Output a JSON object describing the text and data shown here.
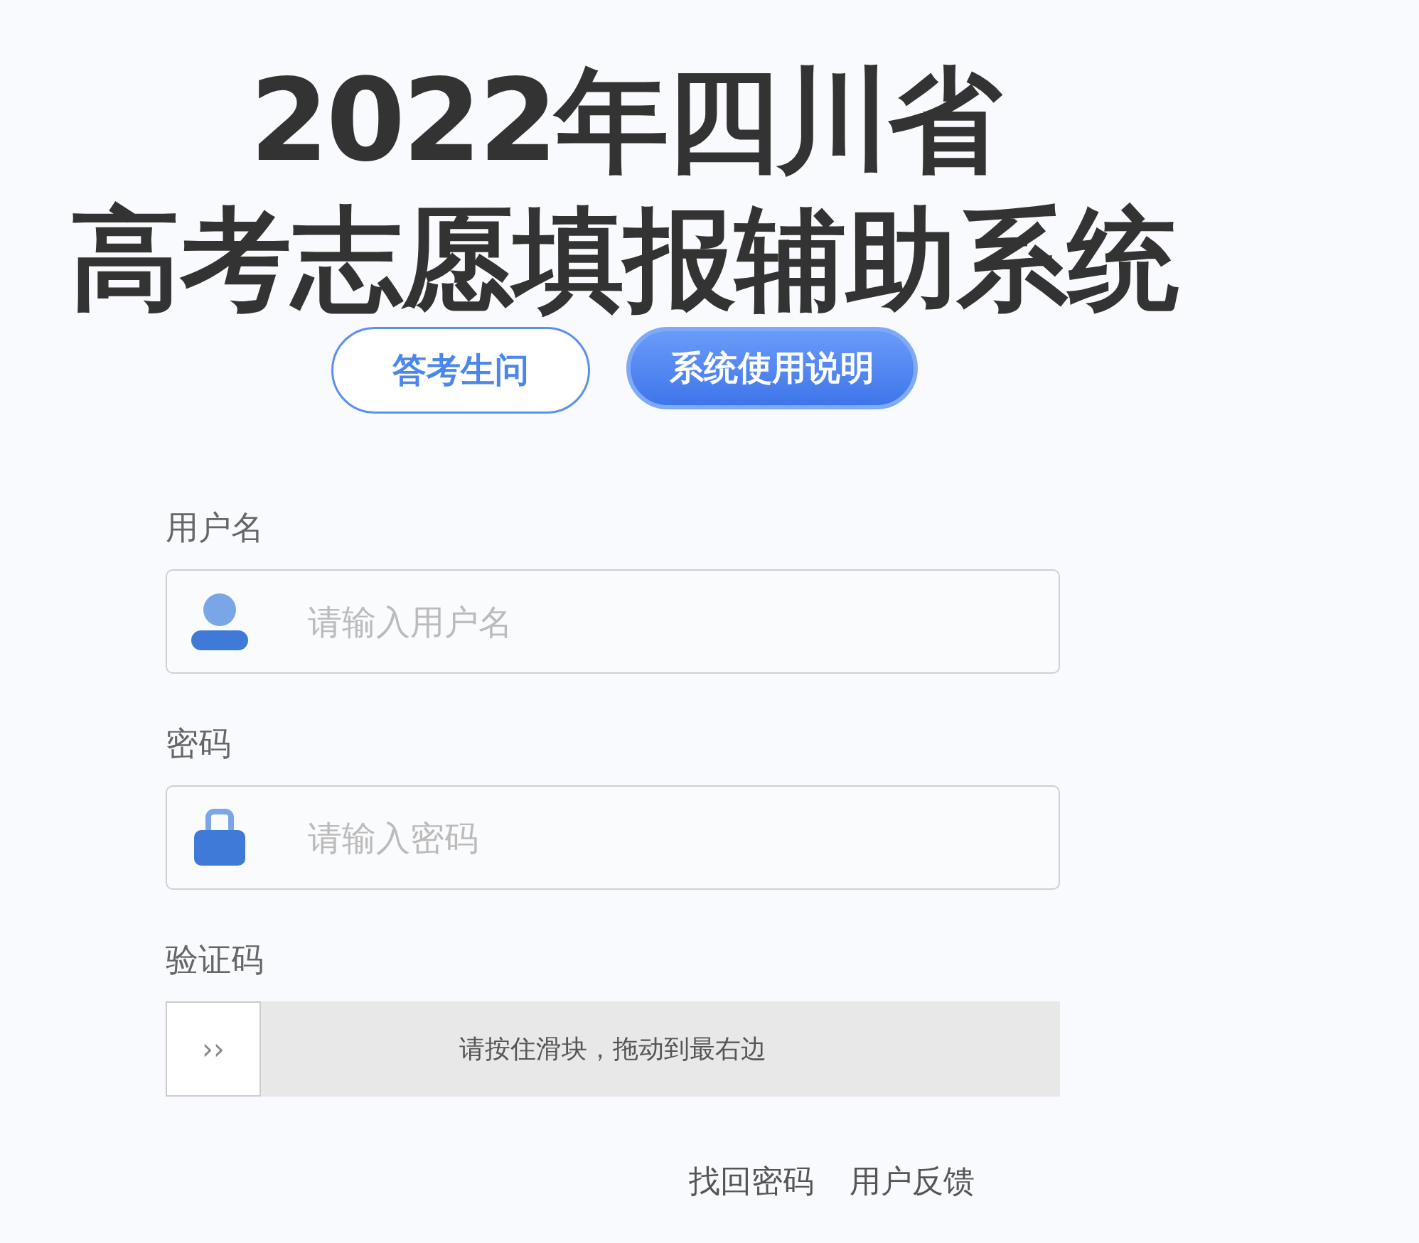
{
  "title": {
    "line_1": "2022年四川省",
    "line_2": "高考志愿填报辅助系统"
  },
  "buttons": [
    {
      "label": "答考生问",
      "kind": "outline"
    },
    {
      "label": "系统使用说明",
      "kind": "filled"
    }
  ],
  "username": {
    "label": "用户名",
    "placeholder": "请输入用户名"
  },
  "password": {
    "label": "密码",
    "placeholder": "请输入密码"
  },
  "captcha": {
    "label": "验证码",
    "handle": "››",
    "hint": "请按住滑块，拖动到最右边",
    "level": 0
  },
  "links": [
    "找回密码",
    "用户反馈"
  ]
}
